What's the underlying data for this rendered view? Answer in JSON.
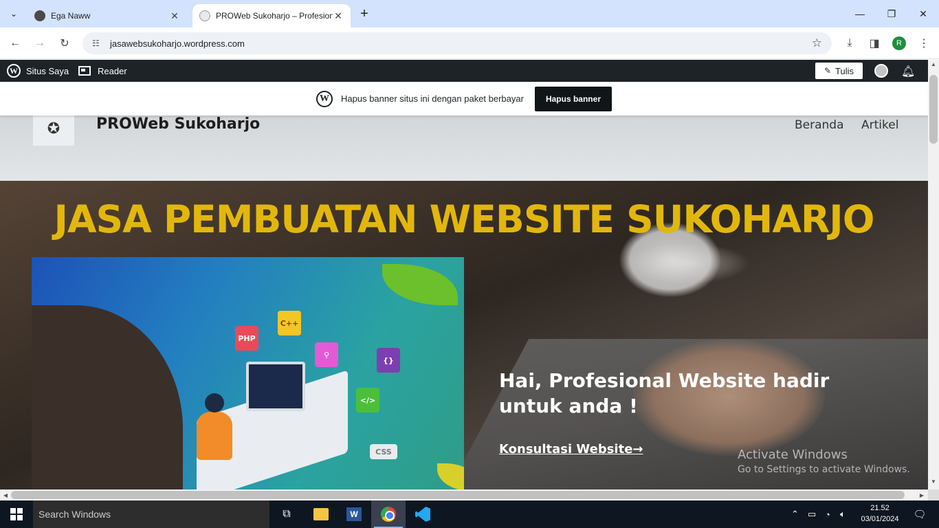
{
  "browser": {
    "tabs": [
      {
        "title": "Ega Naww",
        "active": false
      },
      {
        "title": "PROWeb Sukoharjo – Profesional",
        "active": true
      }
    ],
    "url": "jasawebsukoharjo.wordpress.com",
    "profile_initial": "R"
  },
  "wp_admin_bar": {
    "my_site": "Situs Saya",
    "reader": "Reader",
    "write": "Tulis"
  },
  "banner": {
    "text": "Hapus banner situs ini dengan paket berbayar",
    "button": "Hapus banner"
  },
  "site": {
    "title": "PROWeb Sukoharjo",
    "menu": [
      "Beranda",
      "Artikel"
    ]
  },
  "hero": {
    "headline": "JASA PEMBUATAN WEBSITE SUKOHARJO",
    "tagline": "Hai, Profesional Website hadir untuk anda !",
    "cta": "Konsultasi Website→",
    "chips": [
      "C++",
      "PHP",
      "{}",
      "</>",
      "CSS"
    ]
  },
  "watermark": {
    "line1": "Activate Windows",
    "line2": "Go to Settings to activate Windows."
  },
  "taskbar": {
    "search_placeholder": "Search Windows",
    "time": "21.52",
    "date": "03/01/2024"
  },
  "colors": {
    "headline": "#e2b70c",
    "wp_bar": "#1d2327",
    "tab_strip": "#d3e3fd"
  }
}
